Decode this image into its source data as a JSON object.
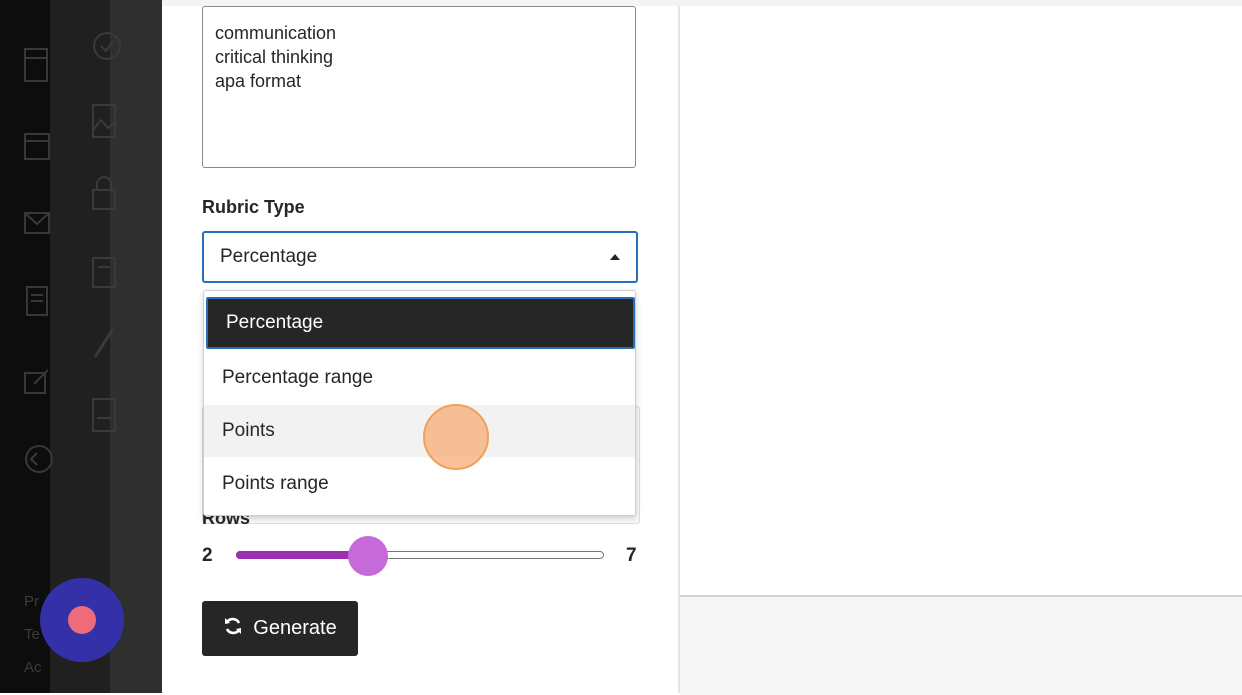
{
  "objectives_text": "communication\ncritical thinking\napa format",
  "rubric_type": {
    "label": "Rubric Type",
    "selected": "Percentage",
    "options": [
      "Percentage",
      "Percentage range",
      "Points",
      "Points range"
    ]
  },
  "rows": {
    "label": "Rows",
    "min": "2",
    "max": "7",
    "value_fraction": 0.36
  },
  "generate": {
    "label": "Generate"
  },
  "sidebar_peek": [
    "Pr",
    "Te",
    "Ac"
  ],
  "colors": {
    "accent_blue": "#2a6ebb",
    "slider_fill": "#9b2fb0",
    "slider_thumb": "#c56ad8",
    "record_button": "#3431a8",
    "record_dot": "#ee6b7a"
  }
}
